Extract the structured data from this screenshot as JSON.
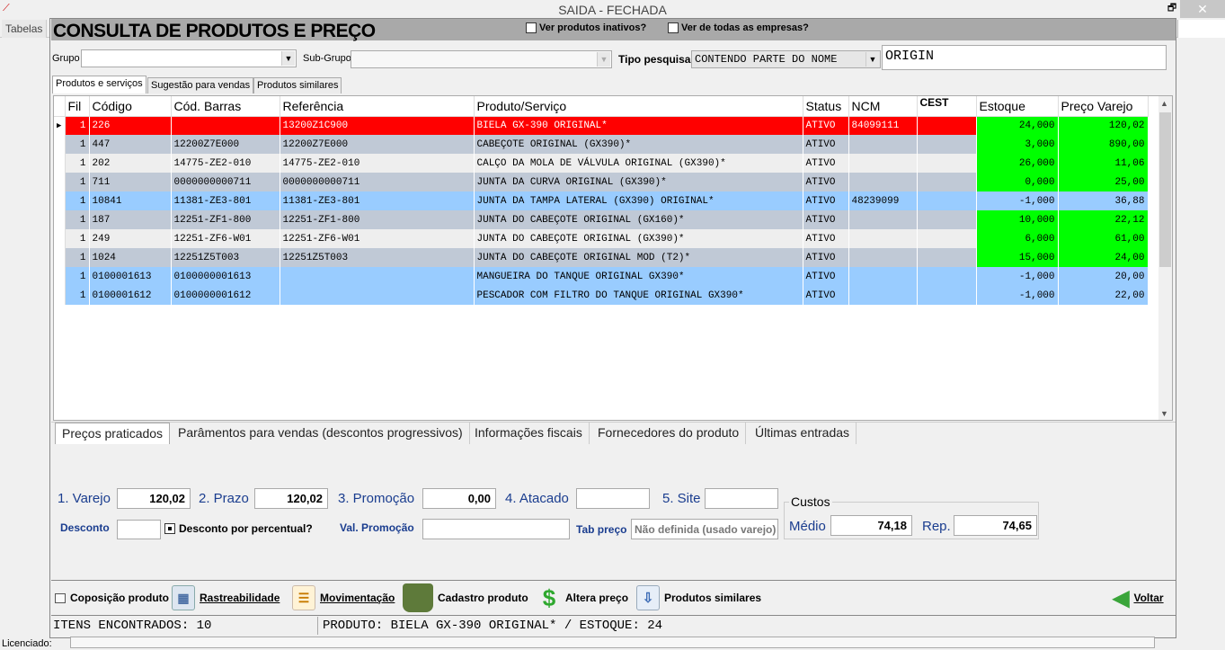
{
  "window": {
    "title": "SAIDA - FECHADA",
    "restore": "🗗",
    "close": "✕"
  },
  "menu": {
    "tabelas": "Tabelas"
  },
  "header": {
    "title": "CONSULTA DE PRODUTOS E PREÇO",
    "inativos": "Ver produtos inativos?",
    "empresas": "Ver de todas as empresas?"
  },
  "filters": {
    "grupo_label": "Grupo",
    "subgrupo_label": "Sub-Grupo",
    "tipo_label": "Tipo pesquisa",
    "tipo_value": "CONTENDO PARTE DO NOME",
    "search_value": "ORIGIN"
  },
  "tabs": [
    "Produtos e serviços",
    "Sugestão para vendas",
    "Produtos similares"
  ],
  "grid": {
    "columns": [
      "Fil",
      "Código",
      "Cód. Barras",
      "Referência",
      "Produto/Serviço",
      "Status",
      "NCM",
      "CEST",
      "Estoque",
      "Preço Varejo"
    ],
    "rows": [
      [
        "1",
        "226",
        "",
        "13200Z1C900",
        "BIELA GX-390 ORIGINAL*",
        "ATIVO",
        "84099111",
        "",
        "24,000",
        "120,02"
      ],
      [
        "1",
        "447",
        "12200Z7E000",
        "12200Z7E000",
        "CABEÇOTE ORIGINAL (GX390)*",
        "ATIVO",
        "",
        "",
        "3,000",
        "890,00"
      ],
      [
        "1",
        "202",
        "14775-ZE2-010",
        "14775-ZE2-010",
        "CALÇO DA MOLA DE VÁLVULA ORIGINAL (GX390)*",
        "ATIVO",
        "",
        "",
        "26,000",
        "11,06"
      ],
      [
        "1",
        "711",
        "0000000000711",
        "0000000000711",
        "JUNTA DA CURVA ORIGINAL (GX390)*",
        "ATIVO",
        "",
        "",
        "0,000",
        "25,00"
      ],
      [
        "1",
        "10841",
        "11381-ZE3-801",
        "11381-ZE3-801",
        "JUNTA DA TAMPA LATERAL (GX390) ORIGINAL*",
        "ATIVO",
        "48239099",
        "",
        "-1,000",
        "36,88"
      ],
      [
        "1",
        "187",
        "12251-ZF1-800",
        "12251-ZF1-800",
        "JUNTA DO CABEÇOTE ORIGINAL (GX160)*",
        "ATIVO",
        "",
        "",
        "10,000",
        "22,12"
      ],
      [
        "1",
        "249",
        "12251-ZF6-W01",
        "12251-ZF6-W01",
        "JUNTA DO CABEÇOTE ORIGINAL (GX390)*",
        "ATIVO",
        "",
        "",
        "6,000",
        "61,00"
      ],
      [
        "1",
        "1024",
        "12251Z5T003",
        "12251Z5T003",
        "JUNTA DO CABEÇOTE ORIGINAL MOD (T2)*",
        "ATIVO",
        "",
        "",
        "15,000",
        "24,00"
      ],
      [
        "1",
        "0100001613",
        "0100000001613",
        "",
        "MANGUEIRA DO TANQUE ORIGINAL GX390*",
        "ATIVO",
        "",
        "",
        "-1,000",
        "20,00"
      ],
      [
        "1",
        "0100001612",
        "0100000001612",
        "",
        "PESCADOR COM FILTRO DO TANQUE ORIGINAL GX390*",
        "ATIVO",
        "",
        "",
        "-1,000",
        "22,00"
      ]
    ],
    "row_styles": [
      "selected",
      "gray",
      "light",
      "gray",
      "blue",
      "gray",
      "light",
      "gray",
      "blue",
      "blue"
    ],
    "colors": {
      "selected": "#ff0000",
      "gray": "#c0c9d6",
      "light": "#eeeeee",
      "blue": "#99ccff",
      "green": "#00ff00"
    }
  },
  "bottom_tabs": [
    "Preços praticados",
    "Parâmentos para vendas (descontos progressivos)",
    "Informações fiscais",
    "Fornecedores do produto",
    "Últimas entradas"
  ],
  "prices": {
    "varejo_label": "1. Varejo",
    "varejo": "120,02",
    "prazo_label": "2. Prazo",
    "prazo": "120,02",
    "promocao_label": "3. Promoção",
    "promocao": "0,00",
    "atacado_label": "4. Atacado",
    "atacado": "",
    "site_label": "5. Site",
    "site": "",
    "desconto_label": "Desconto",
    "desconto": "",
    "desc_perc_label": "Desconto por percentual?",
    "val_promo_label": "Val. Promoção",
    "val_promo": "",
    "tab_preco_label": "Tab preço",
    "tab_preco": "Não definida (usado varejo)",
    "custos_label": "Custos",
    "medio_label": "Médio",
    "medio": "74,18",
    "rep_label": "Rep.",
    "rep": "74,65"
  },
  "toolbar": {
    "composicao": "Coposição produto",
    "rastreabilidade": "Rastreabilidade",
    "movimentacao": "Movimentação",
    "cadastro": "Cadastro  produto",
    "altera": "Altera preço",
    "similares": "Produtos similares",
    "voltar": "Voltar"
  },
  "status": {
    "itens": "ITENS ENCONTRADOS: 10",
    "produto": "PRODUTO: BIELA GX-390 ORIGINAL* / ESTOQUE: 24"
  },
  "footer": {
    "licenciado": "Licenciado:"
  }
}
